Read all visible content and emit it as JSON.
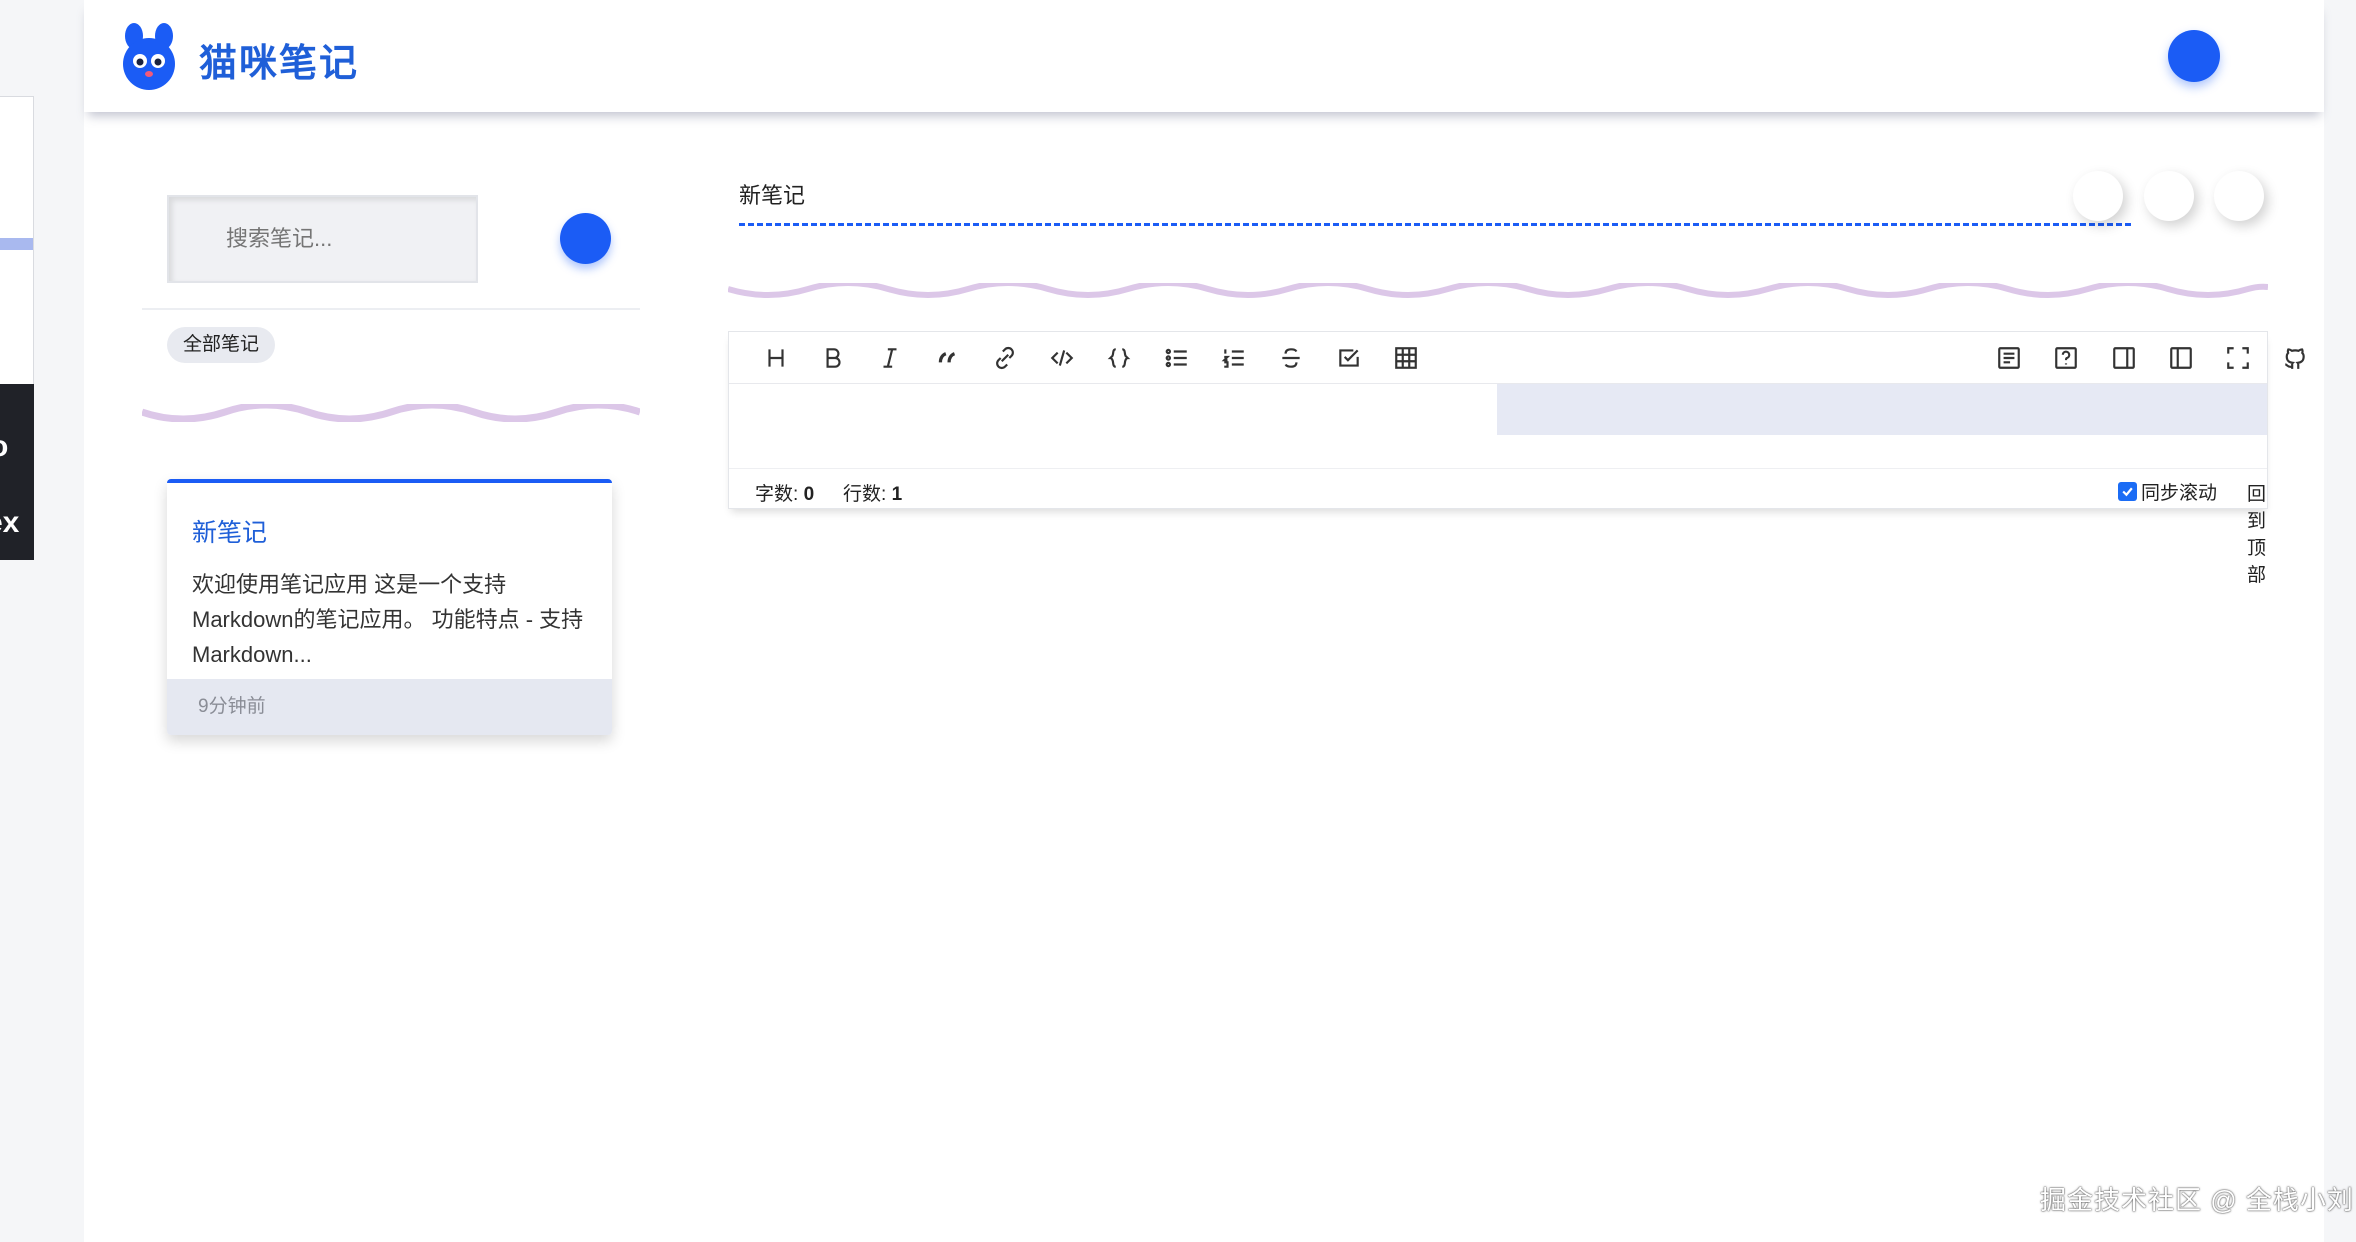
{
  "app": {
    "title": "猫咪笔记",
    "accent_color": "#1b5cf5"
  },
  "ghost_window": {
    "dark_text_1": "o",
    "dark_text_2": "ex"
  },
  "sidebar": {
    "search_placeholder": "搜索笔记...",
    "tag_all": "全部笔记",
    "notes": [
      {
        "title": "新笔记",
        "excerpt": "欢迎使用笔记应用 这是一个支持Markdown的笔记应用。 功能特点 - 支持Markdown...",
        "time": "9分钟前"
      }
    ]
  },
  "editor": {
    "title_value": "新笔记",
    "toolbar_icons": [
      "heading-icon",
      "bold-icon",
      "italic-icon",
      "quote-icon",
      "link-icon",
      "code-icon",
      "code-block-icon",
      "unordered-list-icon",
      "ordered-list-icon",
      "strikethrough-icon",
      "task-list-icon",
      "table-icon"
    ],
    "toolbar_right_icons": [
      "toc-icon",
      "help-icon",
      "preview-only-icon",
      "editor-only-icon",
      "fullscreen-icon",
      "github-icon"
    ],
    "status": {
      "word_label": "字数:",
      "word_count": "0",
      "line_label": "行数:",
      "line_count": "1",
      "sync_scroll": "同步滚动",
      "sync_checked": true,
      "back_to_top": "回到顶部"
    }
  },
  "watermark": "掘金技术社区 @ 全栈小刘"
}
